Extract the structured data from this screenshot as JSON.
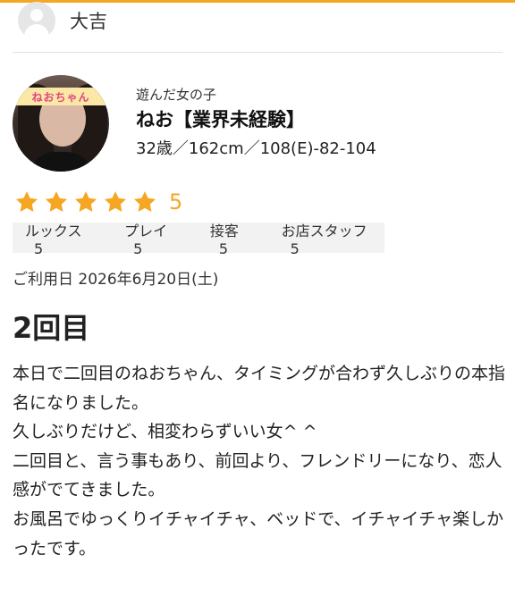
{
  "reviewer": {
    "name": "大吉"
  },
  "girl": {
    "label": "遊んだ女の子",
    "name": "ねお【業界未経験】",
    "stats": "32歳／162cm／108(E)-82-104",
    "photo_banner": "ねおちゃん"
  },
  "rating": {
    "stars": 5,
    "score": "5",
    "star_color": "#f5a623",
    "sub_ratings": [
      {
        "label": "ルックス",
        "value": "5"
      },
      {
        "label": "プレイ",
        "value": "5"
      },
      {
        "label": "接客",
        "value": "5"
      },
      {
        "label": "お店スタッフ",
        "value": "5"
      }
    ]
  },
  "visit_date": "ご利用日 2026年6月20日(土)",
  "review": {
    "title": "2回目",
    "lines": [
      "本日で二回目のねおちゃん、タイミングが合わず久しぶりの本指名になりました。",
      "久しぶりだけど、相変わらずいい女^ ^",
      "二回目と、言う事もあり、前回より、フレンドリーになり、恋人感がでてきました。",
      "お風呂でゆっくりイチャイチャ、ベッドで、イチャイチャ楽しかったです。"
    ]
  },
  "colors": {
    "accent": "#f5a623"
  }
}
